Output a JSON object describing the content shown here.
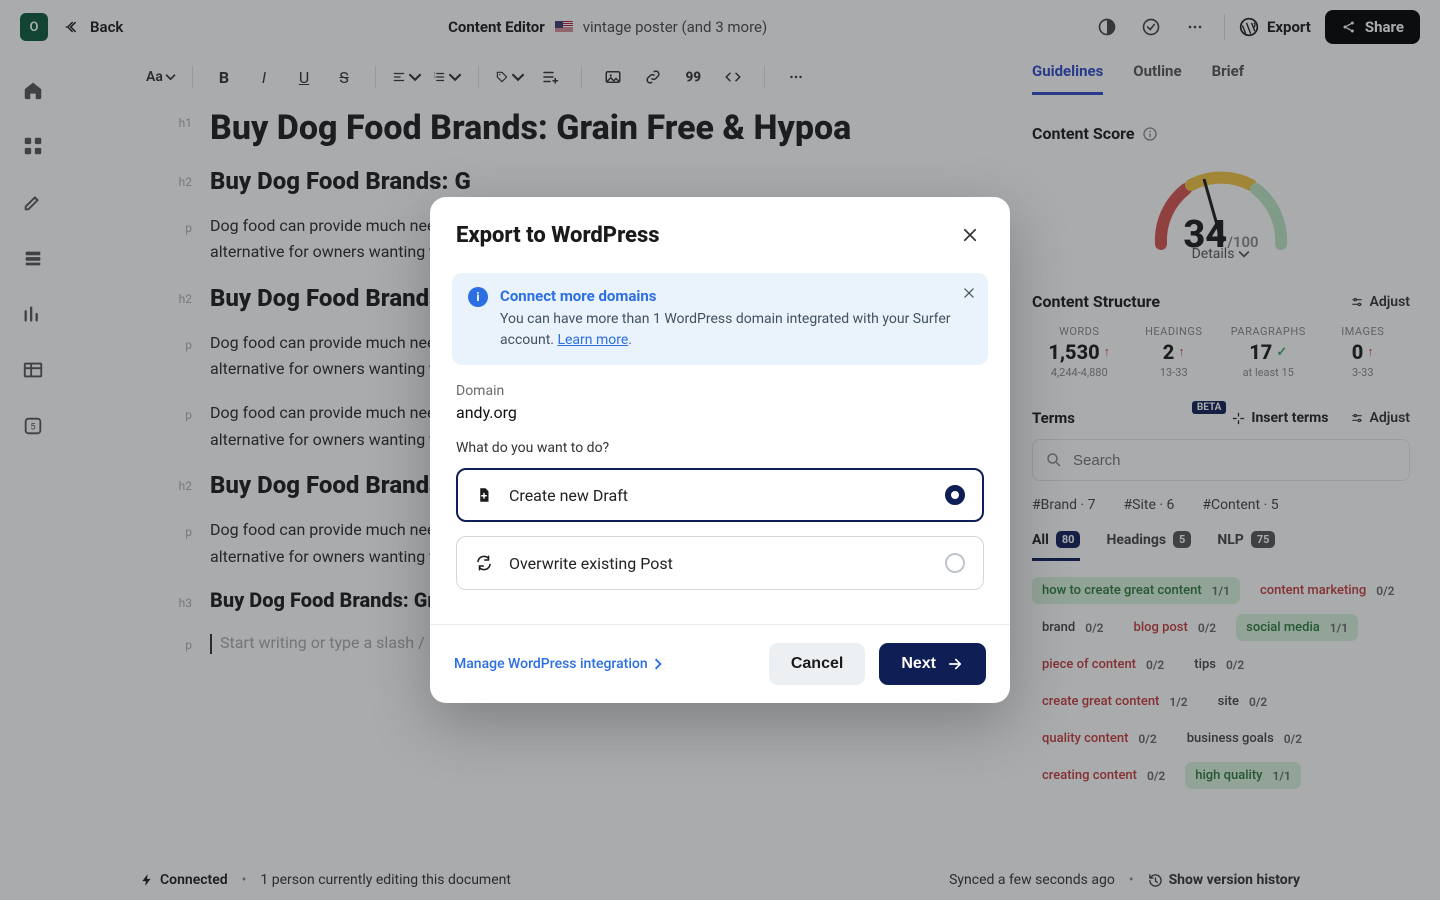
{
  "topbar": {
    "avatar_letter": "O",
    "back_label": "Back",
    "app_name": "Content Editor",
    "keywords": "vintage poster (and 3 more)",
    "export_label": "Export",
    "share_label": "Share"
  },
  "toolbar": {
    "font_label": "Aa"
  },
  "doc": {
    "h1": "Buy Dog Food Brands: Grain Free & Hypoa",
    "h2a": "Buy Dog Food Brands: G",
    "h2b": "Buy Dog Food Brands: G",
    "h2c": "Buy Dog Food Brands: G",
    "h3": "Buy Dog Food Brands: Grain Free & Hypoallergenic",
    "para": "Dog food can provide much needed nutrition for your dog. Dog food also helps with skin sensitivity, great alternative for owners wanting to cut costs.",
    "para_full": "Dog food can provide much needed nutrition for your dog. Dog food also helps with skin sensitivity, great alternative for owners wanting to cut costs.",
    "placeholder": "Start writing or type a slash /",
    "gutters": {
      "h1": "h1",
      "h2": "h2",
      "h3": "h3",
      "p": "p"
    }
  },
  "footer": {
    "connected": "Connected",
    "presence": "1 person currently editing this document",
    "synced": "Synced a few seconds ago",
    "history": "Show version history"
  },
  "rpanel": {
    "tabs": {
      "guidelines": "Guidelines",
      "outline": "Outline",
      "brief": "Brief"
    },
    "score_title": "Content Score",
    "score_value": "34",
    "score_max": "/100",
    "details": "Details",
    "structure_title": "Content Structure",
    "adjust": "Adjust",
    "metrics": {
      "words": {
        "label": "WORDS",
        "value": "1,530",
        "sub": "4,244-4,880",
        "state": "up"
      },
      "headings": {
        "label": "HEADINGS",
        "value": "2",
        "sub": "13-33",
        "state": "up"
      },
      "paragraphs": {
        "label": "PARAGRAPHS",
        "value": "17",
        "sub": "at least 15",
        "state": "ok"
      },
      "images": {
        "label": "IMAGES",
        "value": "0",
        "sub": "3-33",
        "state": "up"
      }
    },
    "terms_title": "Terms",
    "beta": "BETA",
    "insert_terms": "Insert terms",
    "search_placeholder": "Search",
    "hashes": {
      "brand": "#Brand · 7",
      "site": "#Site · 6",
      "content": "#Content · 5"
    },
    "subtabs": {
      "all": "All",
      "all_n": "80",
      "headings": "Headings",
      "headings_n": "5",
      "nlp": "NLP",
      "nlp_n": "75"
    },
    "chips": [
      {
        "name": "how to create great content",
        "cnt": "1/1",
        "cls": "green"
      },
      {
        "name": "content marketing",
        "cnt": "0/2",
        "cls": "red"
      },
      {
        "name": "brand",
        "cnt": "0/2",
        "cls": "plain"
      },
      {
        "name": "blog post",
        "cnt": "0/2",
        "cls": "red"
      },
      {
        "name": "social media",
        "cnt": "1/1",
        "cls": "green"
      },
      {
        "name": "piece of content",
        "cnt": "0/2",
        "cls": "red"
      },
      {
        "name": "tips",
        "cnt": "0/2",
        "cls": "plain"
      },
      {
        "name": "create great content",
        "cnt": "1/2",
        "cls": "red"
      },
      {
        "name": "site",
        "cnt": "0/2",
        "cls": "plain"
      },
      {
        "name": "quality content",
        "cnt": "0/2",
        "cls": "red"
      },
      {
        "name": "business goals",
        "cnt": "0/2",
        "cls": "plain"
      },
      {
        "name": "creating content",
        "cnt": "0/2",
        "cls": "red"
      },
      {
        "name": "high quality",
        "cnt": "1/1",
        "cls": "green"
      }
    ]
  },
  "modal": {
    "title": "Export to WordPress",
    "banner_title": "Connect more domains",
    "banner_body": "You can have more than 1 WordPress domain integrated with your Surfer account. ",
    "banner_link": "Learn more",
    "domain_label": "Domain",
    "domain_value": "andy.org",
    "question": "What do you want to do?",
    "opt_create": "Create new Draft",
    "opt_overwrite": "Overwrite existing Post",
    "manage": "Manage WordPress integration",
    "cancel": "Cancel",
    "next": "Next"
  }
}
